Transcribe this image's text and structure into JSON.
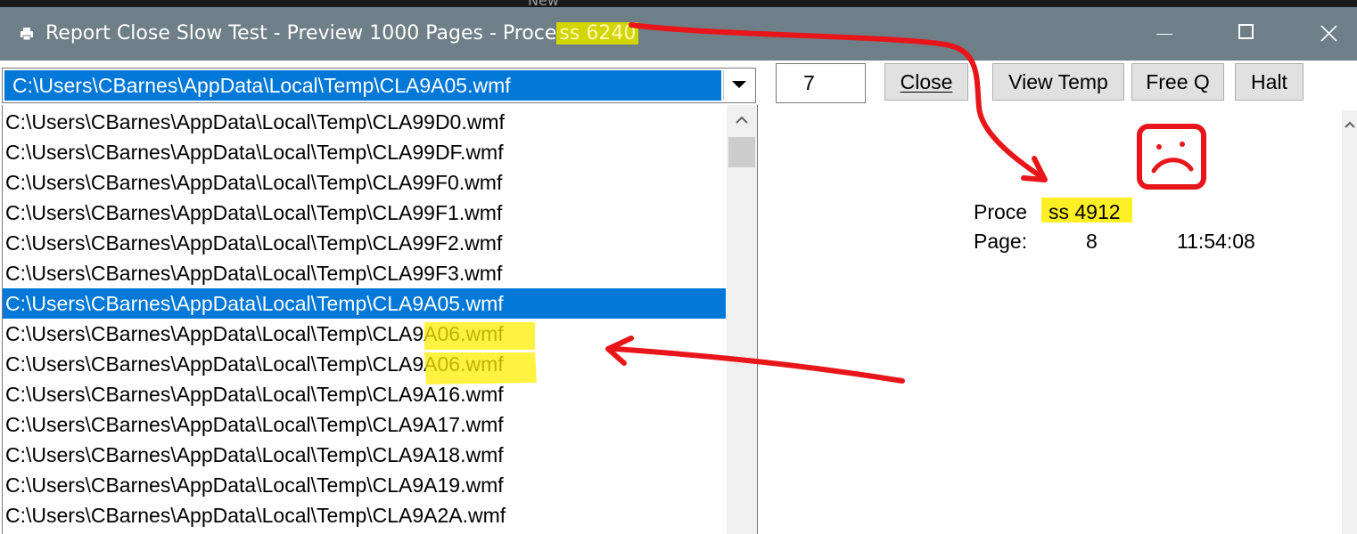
{
  "window": {
    "title_prefix": "Report Close Slow Test - Preview 1000 Pages - Proce",
    "title_highlight": "ss 6240",
    "background_ghost_text": "New"
  },
  "combo": {
    "selected_value": "C:\\Users\\CBarnes\\AppData\\Local\\Temp\\CLA9A05.wmf"
  },
  "list": {
    "items": [
      {
        "text": "C:\\Users\\CBarnes\\AppData\\Local\\Temp\\CLA99D0.wmf",
        "selected": false
      },
      {
        "text": "C:\\Users\\CBarnes\\AppData\\Local\\Temp\\CLA99DF.wmf",
        "selected": false
      },
      {
        "text": "C:\\Users\\CBarnes\\AppData\\Local\\Temp\\CLA99F0.wmf",
        "selected": false
      },
      {
        "text": "C:\\Users\\CBarnes\\AppData\\Local\\Temp\\CLA99F1.wmf",
        "selected": false
      },
      {
        "text": "C:\\Users\\CBarnes\\AppData\\Local\\Temp\\CLA99F2.wmf",
        "selected": false
      },
      {
        "text": "C:\\Users\\CBarnes\\AppData\\Local\\Temp\\CLA99F3.wmf",
        "selected": false
      },
      {
        "text": "C:\\Users\\CBarnes\\AppData\\Local\\Temp\\CLA9A05.wmf",
        "selected": true
      },
      {
        "text": "C:\\Users\\CBarnes\\AppData\\Local\\Temp\\CLA9A06.wmf",
        "selected": false
      },
      {
        "text": "C:\\Users\\CBarnes\\AppData\\Local\\Temp\\CLA9A06.wmf",
        "selected": false
      },
      {
        "text": "C:\\Users\\CBarnes\\AppData\\Local\\Temp\\CLA9A16.wmf",
        "selected": false
      },
      {
        "text": "C:\\Users\\CBarnes\\AppData\\Local\\Temp\\CLA9A17.wmf",
        "selected": false
      },
      {
        "text": "C:\\Users\\CBarnes\\AppData\\Local\\Temp\\CLA9A18.wmf",
        "selected": false
      },
      {
        "text": "C:\\Users\\CBarnes\\AppData\\Local\\Temp\\CLA9A19.wmf",
        "selected": false
      },
      {
        "text": "C:\\Users\\CBarnes\\AppData\\Local\\Temp\\CLA9A2A.wmf",
        "selected": false
      }
    ]
  },
  "toolbar": {
    "count_value": "7",
    "close_label": "Close",
    "view_temp_label": "View Temp",
    "free_q_label": "Free Q",
    "halt_label": "Halt"
  },
  "status": {
    "process_label": "Proce",
    "process_value": "ss 4912",
    "page_label": "Page:",
    "page_value": "8",
    "time": "11:54:08"
  },
  "colors": {
    "titlebar": "#6f7f88",
    "selection": "#0078d7",
    "annotation_red": "#e8161b",
    "highlight_yellow": "#ffed00"
  },
  "icons": [
    "printer-icon",
    "minimize-icon",
    "maximize-icon",
    "close-icon",
    "chevron-down-icon",
    "scroll-up-icon",
    "sad-face-icon"
  ]
}
